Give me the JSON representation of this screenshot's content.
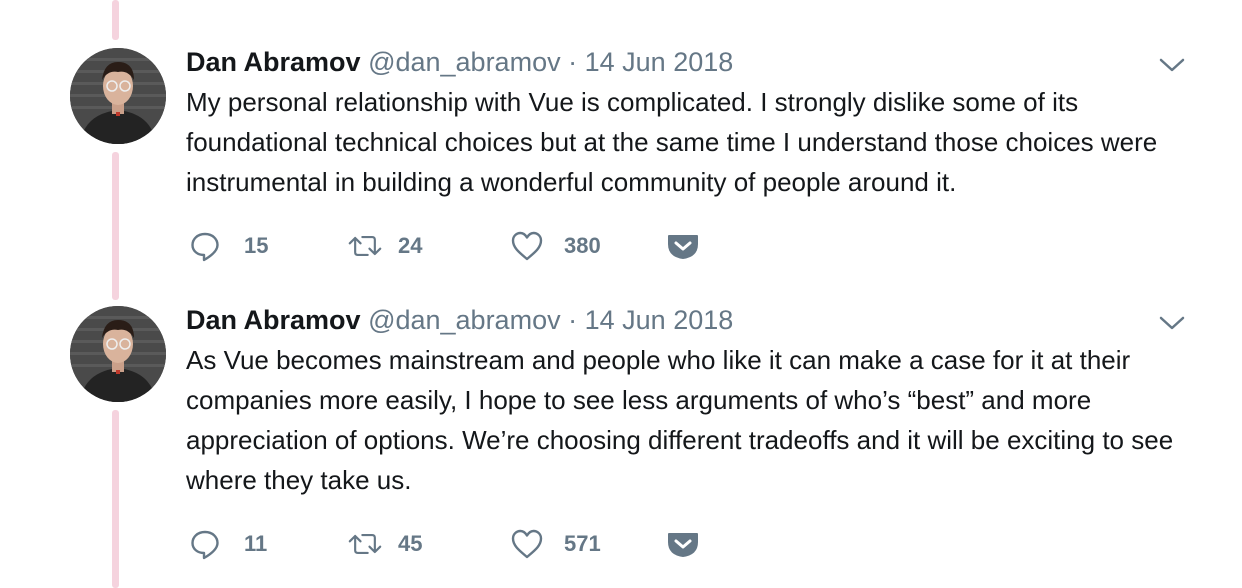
{
  "thread": {
    "accent_color": "#f5d3de"
  },
  "tweets": [
    {
      "author_name": "Dan Abramov",
      "handle": "@dan_abramov",
      "separator": "·",
      "date": "14 Jun 2018",
      "text": "My personal relationship with Vue is complicated. I strongly dislike some of its foundational technical choices but at the same time I understand those choices were instrumental in building a wonderful community of people around it.",
      "replies": "15",
      "retweets": "24",
      "likes": "380"
    },
    {
      "author_name": "Dan Abramov",
      "handle": "@dan_abramov",
      "separator": "·",
      "date": "14 Jun 2018",
      "text": "As Vue becomes mainstream and people who like it can make a case for it at their companies more easily, I hope to see less arguments of who’s “best” and more appreciation of options. We’re choosing different tradeoffs and it will be exciting to see where they take us.",
      "replies": "11",
      "retweets": "45",
      "likes": "571"
    }
  ],
  "icons": {
    "reply": "reply-icon",
    "retweet": "retweet-icon",
    "like": "heart-icon",
    "pocket": "pocket-icon",
    "menu": "chevron-down-icon"
  }
}
